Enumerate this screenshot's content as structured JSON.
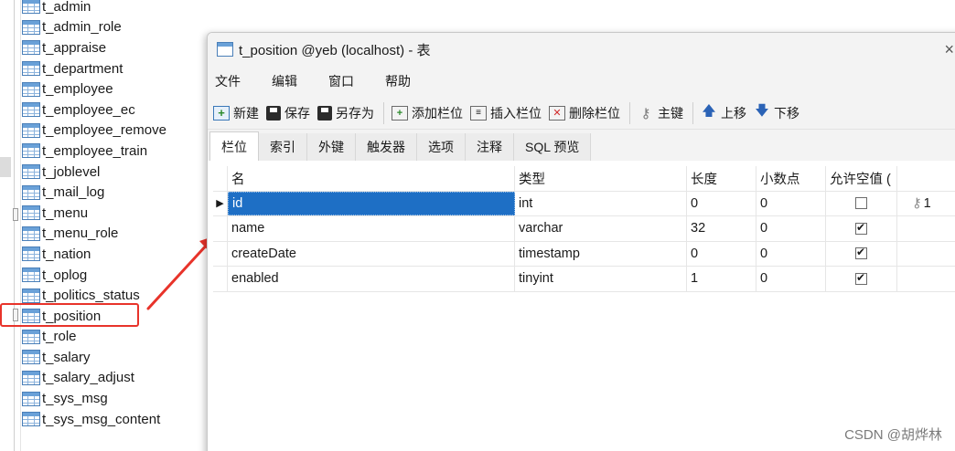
{
  "tree": {
    "items": [
      {
        "label": "t_admin"
      },
      {
        "label": "t_admin_role"
      },
      {
        "label": "t_appraise"
      },
      {
        "label": "t_department"
      },
      {
        "label": "t_employee"
      },
      {
        "label": "t_employee_ec"
      },
      {
        "label": "t_employee_remove"
      },
      {
        "label": "t_employee_train"
      },
      {
        "label": "t_joblevel"
      },
      {
        "label": "t_mail_log"
      },
      {
        "label": "t_menu"
      },
      {
        "label": "t_menu_role"
      },
      {
        "label": "t_nation"
      },
      {
        "label": "t_oplog"
      },
      {
        "label": "t_politics_status"
      },
      {
        "label": "t_position"
      },
      {
        "label": "t_role"
      },
      {
        "label": "t_salary"
      },
      {
        "label": "t_salary_adjust"
      },
      {
        "label": "t_sys_msg"
      },
      {
        "label": "t_sys_msg_content"
      }
    ],
    "highlighted": "t_position"
  },
  "window": {
    "title": "t_position @yeb (localhost) - 表",
    "menu": [
      "文件",
      "编辑",
      "窗口",
      "帮助"
    ],
    "toolbar": {
      "new": "新建",
      "save": "保存",
      "save_as": "另存为",
      "add_field": "添加栏位",
      "insert_field": "插入栏位",
      "delete_field": "删除栏位",
      "primary_key": "主键",
      "move_up": "上移",
      "move_down": "下移"
    },
    "tabs": [
      "栏位",
      "索引",
      "外键",
      "触发器",
      "选项",
      "注释",
      "SQL 预览"
    ],
    "grid": {
      "headers": {
        "name": "名",
        "type": "类型",
        "length": "长度",
        "decimals": "小数点",
        "nullable": "允许空值 ("
      },
      "rows": [
        {
          "name": "id",
          "type": "int",
          "length": "0",
          "decimals": "0",
          "nullable": false,
          "key": "1"
        },
        {
          "name": "name",
          "type": "varchar",
          "length": "32",
          "decimals": "0",
          "nullable": true,
          "key": ""
        },
        {
          "name": "createDate",
          "type": "timestamp",
          "length": "0",
          "decimals": "0",
          "nullable": true,
          "key": ""
        },
        {
          "name": "enabled",
          "type": "tinyint",
          "length": "1",
          "decimals": "0",
          "nullable": true,
          "key": ""
        }
      ]
    }
  },
  "watermark": "CSDN @胡烨林",
  "colors": {
    "highlight_box": "#e8332a",
    "selection": "#1e6fc5",
    "arrow": "#e8332a"
  }
}
